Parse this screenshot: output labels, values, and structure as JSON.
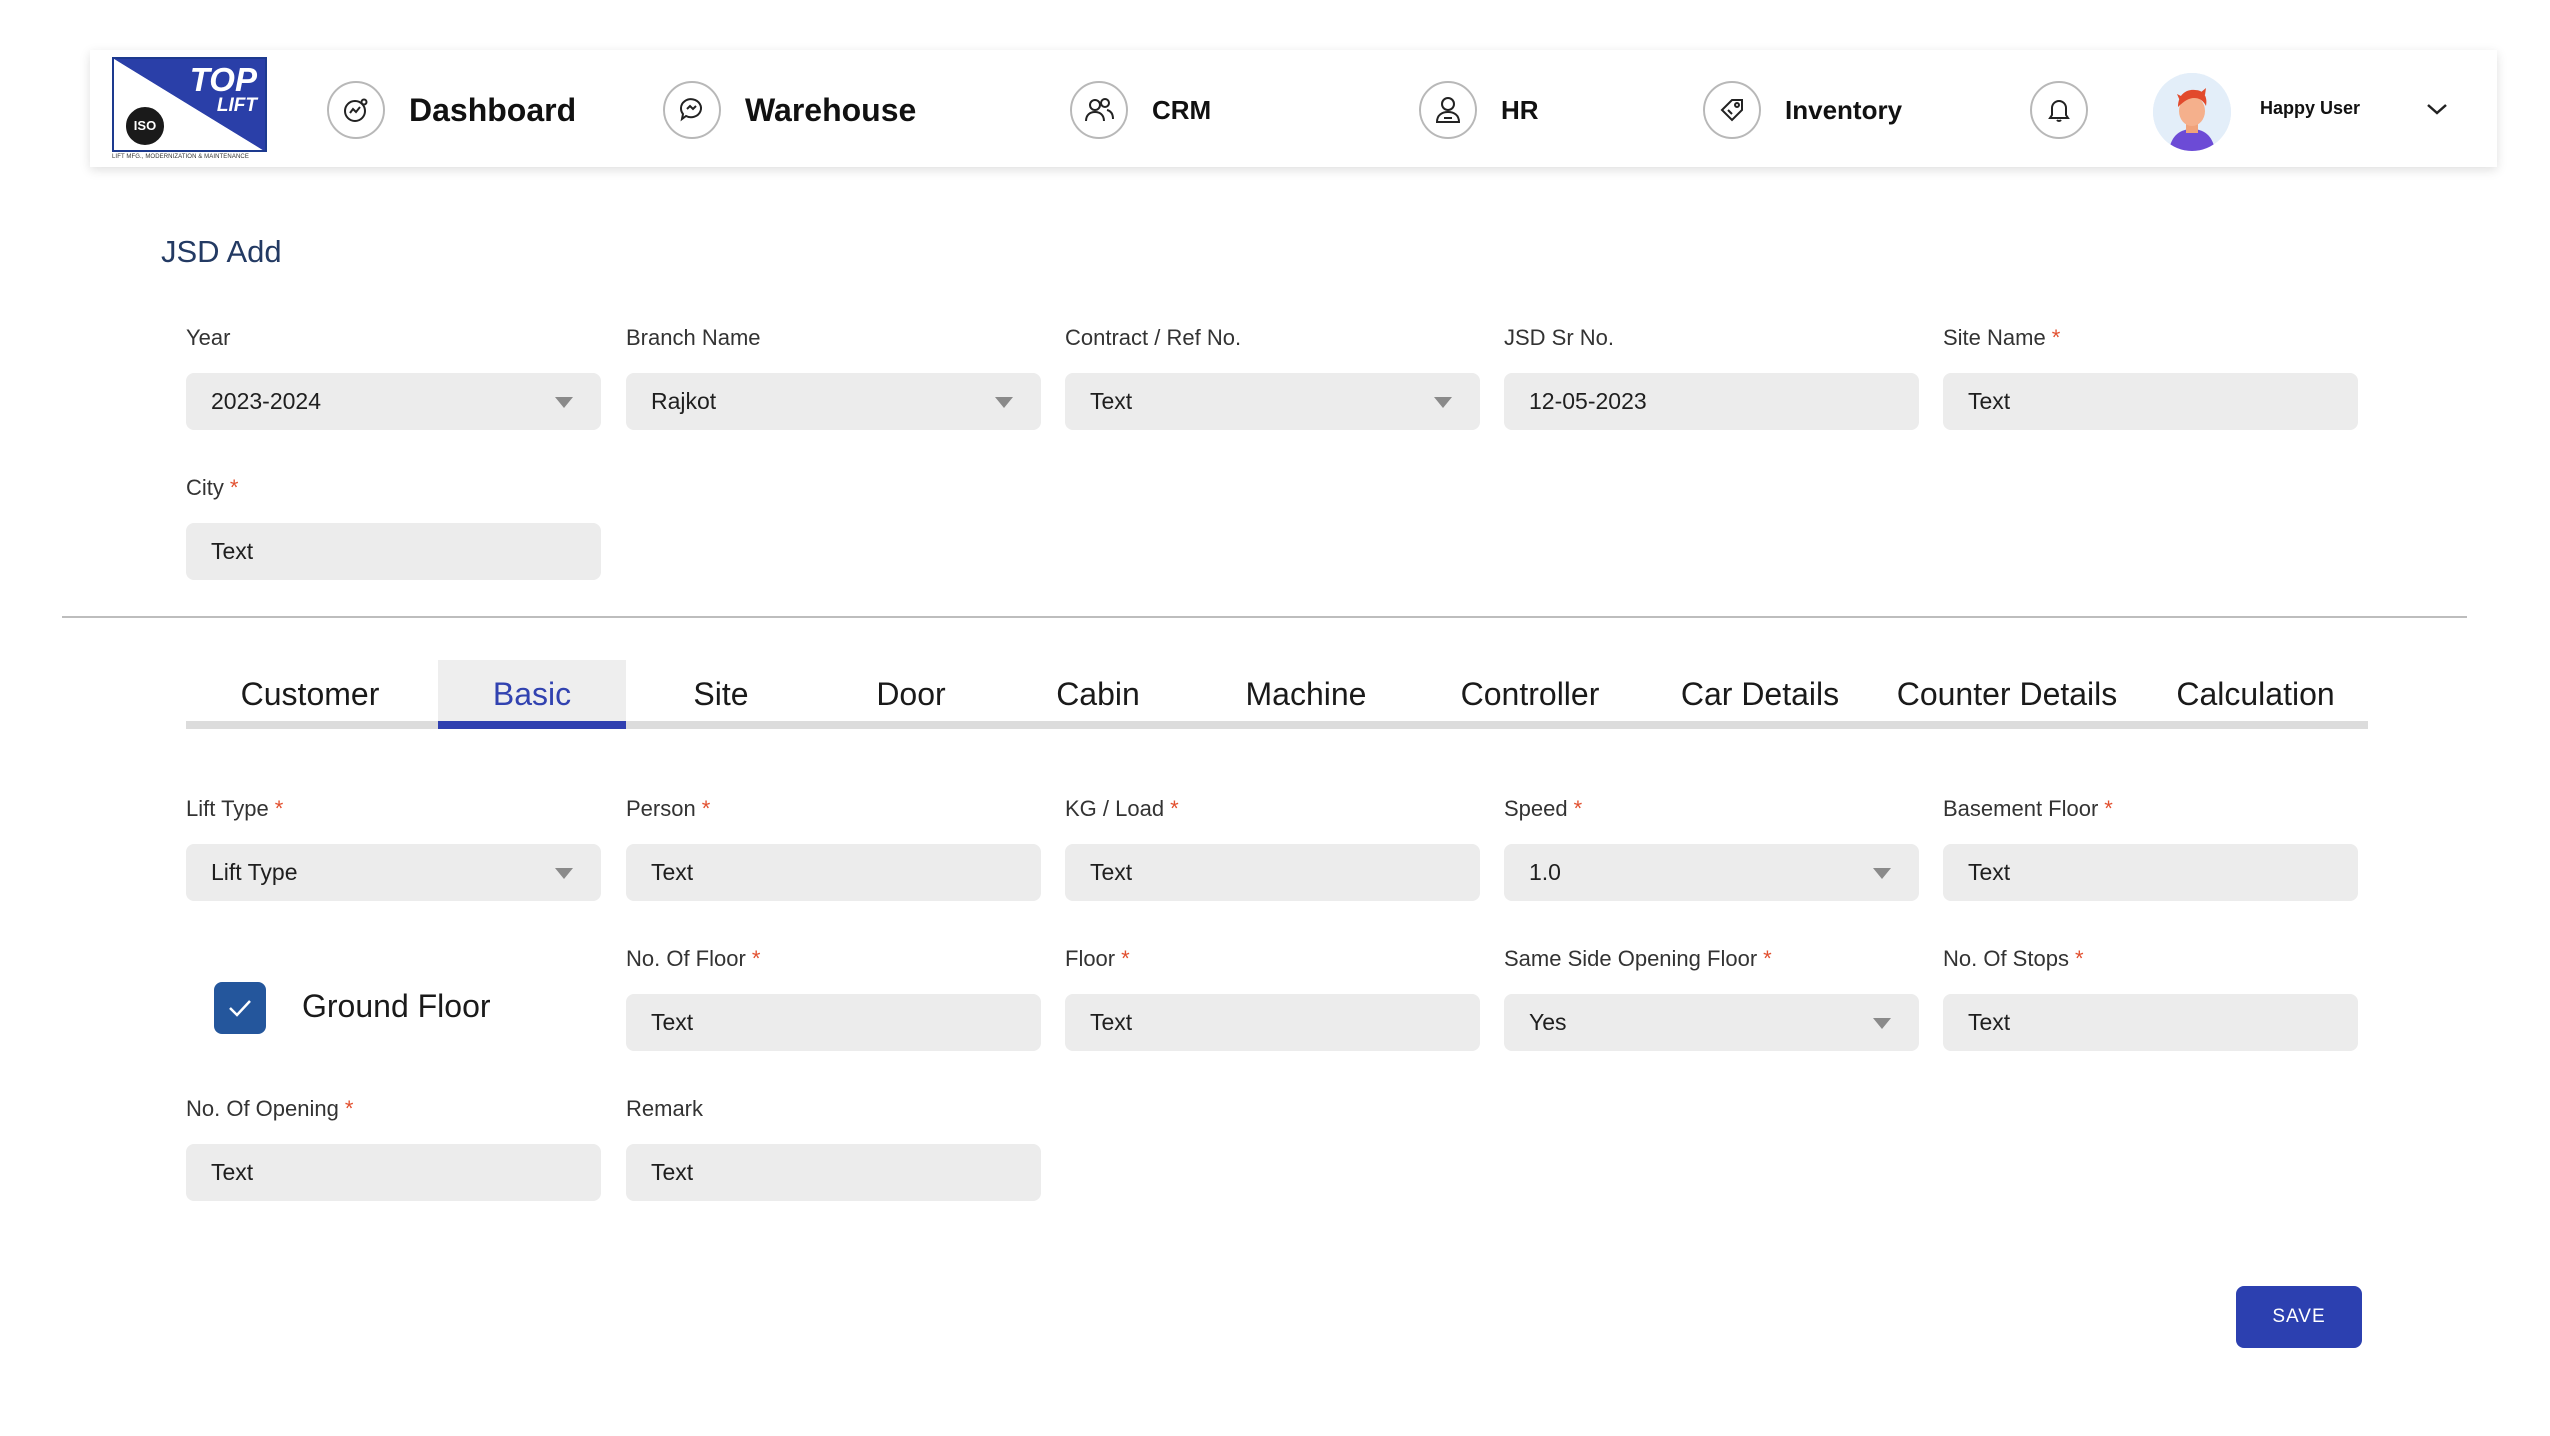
{
  "header": {
    "logo": {
      "top": "TOP",
      "lift": "LIFT",
      "iso": "ISO",
      "tagline": "LIFT MFG., MODERNIZATION & MAINTENANCE"
    },
    "nav": [
      {
        "label": "Dashboard",
        "icon": "dashboard-icon"
      },
      {
        "label": "Warehouse",
        "icon": "chat-icon"
      },
      {
        "label": "CRM",
        "icon": "users-icon"
      },
      {
        "label": "HR",
        "icon": "person-icon"
      },
      {
        "label": "Inventory",
        "icon": "tag-icon"
      }
    ],
    "user": {
      "name": "Happy User"
    }
  },
  "page": {
    "title": "JSD Add"
  },
  "top_form": {
    "year": {
      "label": "Year",
      "value": "2023-2024"
    },
    "branch": {
      "label": "Branch Name",
      "value": "Rajkot"
    },
    "contract": {
      "label": "Contract / Ref No.",
      "value": "Text"
    },
    "jsd_sr": {
      "label": "JSD Sr No.",
      "value": "12-05-2023"
    },
    "site_name": {
      "label": "Site Name",
      "value": "Text",
      "required": "*"
    },
    "city": {
      "label": "City",
      "value": "Text",
      "required": "*"
    }
  },
  "tabs": [
    "Customer",
    "Basic",
    "Site",
    "Door",
    "Cabin",
    "Machine",
    "Controller",
    "Car Details",
    "Counter Details",
    "Calculation"
  ],
  "active_tab": "Basic",
  "basic": {
    "lift_type": {
      "label": "Lift Type",
      "value": "Lift Type",
      "required": "*"
    },
    "person": {
      "label": "Person",
      "value": "Text",
      "required": "*"
    },
    "kg_load": {
      "label": "KG / Load",
      "value": "Text",
      "required": "*"
    },
    "speed": {
      "label": "Speed",
      "value": "1.0",
      "required": "*"
    },
    "basement_floor": {
      "label": "Basement Floor",
      "value": "Text",
      "required": "*"
    },
    "ground_floor": {
      "label": "Ground Floor",
      "checked": true
    },
    "no_of_floor": {
      "label": "No. Of Floor",
      "value": "Text",
      "required": "*"
    },
    "floor": {
      "label": "Floor",
      "value": "Text",
      "required": "*"
    },
    "same_side": {
      "label": "Same Side Opening Floor",
      "value": "Yes",
      "required": "*"
    },
    "no_of_stops": {
      "label": "No. Of Stops",
      "value": "Text",
      "required": "*"
    },
    "no_of_opening": {
      "label": "No. Of Opening",
      "value": "Text",
      "required": "*"
    },
    "remark": {
      "label": "Remark",
      "value": "Text"
    }
  },
  "actions": {
    "save": "SAVE"
  },
  "colors": {
    "accent": "#2c40b0",
    "title": "#233a63",
    "required": "#e2502f",
    "checkbox": "#24569c",
    "field_bg": "#ececec"
  }
}
